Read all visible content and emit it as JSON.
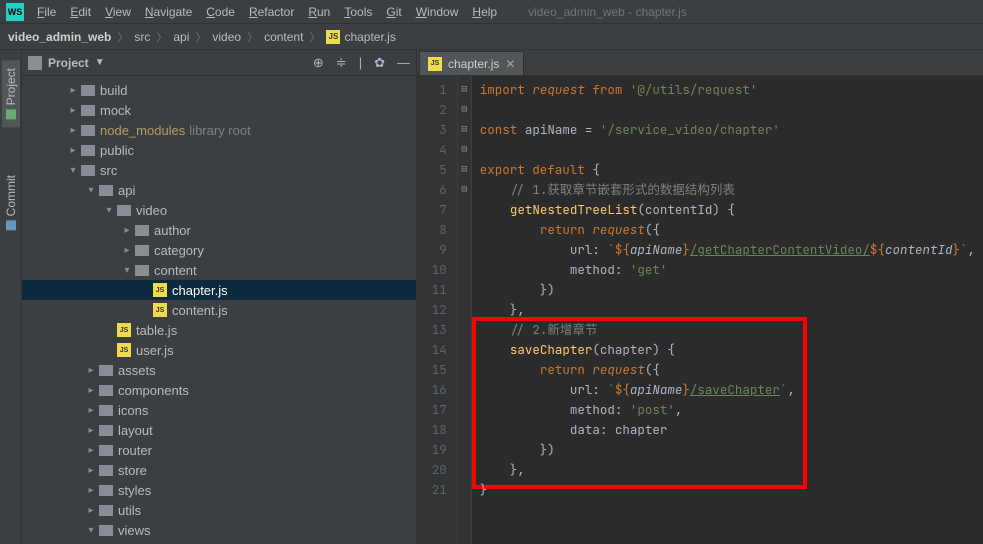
{
  "window": {
    "title": "video_admin_web - chapter.js"
  },
  "menu": {
    "items": [
      "File",
      "Edit",
      "View",
      "Navigate",
      "Code",
      "Refactor",
      "Run",
      "Tools",
      "Git",
      "Window",
      "Help"
    ]
  },
  "breadcrumb": {
    "project": "video_admin_web",
    "parts": [
      "src",
      "api",
      "video",
      "content"
    ],
    "file": "chapter.js"
  },
  "sidebar_tabs": {
    "project": "Project",
    "commit": "Commit"
  },
  "project_panel": {
    "title": "Project",
    "tree": [
      {
        "depth": 0,
        "exp": "▸",
        "kind": "folder",
        "label": "build"
      },
      {
        "depth": 0,
        "exp": "▸",
        "kind": "folder",
        "label": "mock"
      },
      {
        "depth": 0,
        "exp": "▸",
        "kind": "folder",
        "label": "node_modules",
        "lib": true,
        "aux": "library root"
      },
      {
        "depth": 0,
        "exp": "▸",
        "kind": "folder",
        "label": "public"
      },
      {
        "depth": 0,
        "exp": "▾",
        "kind": "folder",
        "label": "src"
      },
      {
        "depth": 1,
        "exp": "▾",
        "kind": "folder",
        "label": "api"
      },
      {
        "depth": 2,
        "exp": "▾",
        "kind": "folder",
        "label": "video"
      },
      {
        "depth": 3,
        "exp": "▸",
        "kind": "folder",
        "label": "author"
      },
      {
        "depth": 3,
        "exp": "▸",
        "kind": "folder",
        "label": "category"
      },
      {
        "depth": 3,
        "exp": "▾",
        "kind": "folder",
        "label": "content"
      },
      {
        "depth": 4,
        "exp": " ",
        "kind": "js",
        "label": "chapter.js",
        "selected": true
      },
      {
        "depth": 4,
        "exp": " ",
        "kind": "js",
        "label": "content.js"
      },
      {
        "depth": 2,
        "exp": " ",
        "kind": "js",
        "label": "table.js"
      },
      {
        "depth": 2,
        "exp": " ",
        "kind": "js",
        "label": "user.js"
      },
      {
        "depth": 1,
        "exp": "▸",
        "kind": "folder",
        "label": "assets"
      },
      {
        "depth": 1,
        "exp": "▸",
        "kind": "folder",
        "label": "components"
      },
      {
        "depth": 1,
        "exp": "▸",
        "kind": "folder",
        "label": "icons"
      },
      {
        "depth": 1,
        "exp": "▸",
        "kind": "folder",
        "label": "layout"
      },
      {
        "depth": 1,
        "exp": "▸",
        "kind": "folder",
        "label": "router"
      },
      {
        "depth": 1,
        "exp": "▸",
        "kind": "folder",
        "label": "store"
      },
      {
        "depth": 1,
        "exp": "▸",
        "kind": "folder",
        "label": "styles"
      },
      {
        "depth": 1,
        "exp": "▸",
        "kind": "folder",
        "label": "utils"
      },
      {
        "depth": 1,
        "exp": "▾",
        "kind": "folder",
        "label": "views"
      }
    ]
  },
  "editor_tab": {
    "label": "chapter.js"
  },
  "code": {
    "lines_count": 21,
    "lines_html": [
      "<span class='c-kw'>import</span> <span class='c-req'>request</span> <span class='c-kw'>from</span> <span class='c-str'>'@/utils/request'</span>",
      "",
      "<span class='c-kw'>const</span> <span class='c-id'>apiName</span> = <span class='c-str'>'/service_video/chapter'</span>",
      "",
      "<span class='c-kw'>export default</span> {",
      "    <span class='c-cmt'>// 1.获取章节嵌套形式的数据结构列表</span>",
      "    <span class='c-fn'>getNestedTreeList</span>(contentId) {",
      "        <span class='c-kw'>return</span> <span class='c-req'>request</span>({",
      "            <span class='c-id'>url</span>: <span class='c-str'>`</span><span class='c-tmpl'>${</span><span class='c-tmplv'>apiName</span><span class='c-tmpl'>}</span><span class='c-strlink'>/getChapterContentVideo/</span><span class='c-tmpl'>${</span><span class='c-tmplv'>contentId</span><span class='c-tmpl'>}</span><span class='c-str'>`</span>,",
      "            <span class='c-id'>method</span>: <span class='c-str'>'get'</span>",
      "        })",
      "    },",
      "    <span class='c-cmt'>// 2.新增章节</span>",
      "    <span class='c-fn'>saveChapter</span>(chapter) {",
      "        <span class='c-kw'>return</span> <span class='c-req'>request</span>({",
      "            <span class='c-id'>url</span>: <span class='c-str'>`</span><span class='c-tmpl'>${</span><span class='c-tmplv'>apiName</span><span class='c-tmpl'>}</span><span class='c-strlink'>/saveChapter</span><span class='c-str'>`</span>,",
      "            <span class='c-id'>method</span>: <span class='c-str'>'post'</span>,",
      "            <span class='c-id'>data</span>: chapter",
      "        })",
      "    },",
      "}"
    ],
    "fold_marks": {
      "5": "⊟",
      "6": "",
      "7": "⊟",
      "8": "⊟",
      "11": "",
      "12": "",
      "13": "",
      "14": "⊟",
      "15": "⊟",
      "19": "",
      "20": "",
      "21": "⊟"
    }
  }
}
